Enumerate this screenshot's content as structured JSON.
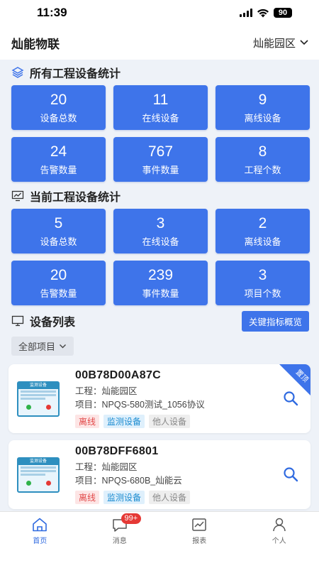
{
  "status_bar": {
    "time": "11:39",
    "battery": "90"
  },
  "header": {
    "title": "灿能物联",
    "park": "灿能园区"
  },
  "all_stats": {
    "title": "所有工程设备统计",
    "cards": [
      {
        "value": "20",
        "label": "设备总数"
      },
      {
        "value": "11",
        "label": "在线设备"
      },
      {
        "value": "9",
        "label": "离线设备"
      },
      {
        "value": "24",
        "label": "告警数量"
      },
      {
        "value": "767",
        "label": "事件数量"
      },
      {
        "value": "8",
        "label": "工程个数"
      }
    ]
  },
  "current_stats": {
    "title": "当前工程设备统计",
    "cards": [
      {
        "value": "5",
        "label": "设备总数"
      },
      {
        "value": "3",
        "label": "在线设备"
      },
      {
        "value": "2",
        "label": "离线设备"
      },
      {
        "value": "20",
        "label": "告警数量"
      },
      {
        "value": "239",
        "label": "事件数量"
      },
      {
        "value": "3",
        "label": "项目个数"
      }
    ]
  },
  "device_list": {
    "title": "设备列表",
    "kpi_button": "关键指标概览",
    "filter": "全部项目",
    "items": [
      {
        "id": "00B78D00A87C",
        "project_line": "工程：灿能园区",
        "item_line": "项目：NPQS-580测试_1056协议",
        "tags": [
          "离线",
          "监测设备",
          "他人设备"
        ],
        "corner": "置顶",
        "thumb_title": "监测设备"
      },
      {
        "id": "00B78DFF6801",
        "project_line": "工程：灿能园区",
        "item_line": "项目：NPQS-680B_灿能云",
        "tags": [
          "离线",
          "监测设备",
          "他人设备"
        ],
        "thumb_title": "监测设备"
      }
    ]
  },
  "tabbar": {
    "items": [
      {
        "label": "首页"
      },
      {
        "label": "消息",
        "badge": "99+"
      },
      {
        "label": "报表"
      },
      {
        "label": "个人"
      }
    ]
  }
}
